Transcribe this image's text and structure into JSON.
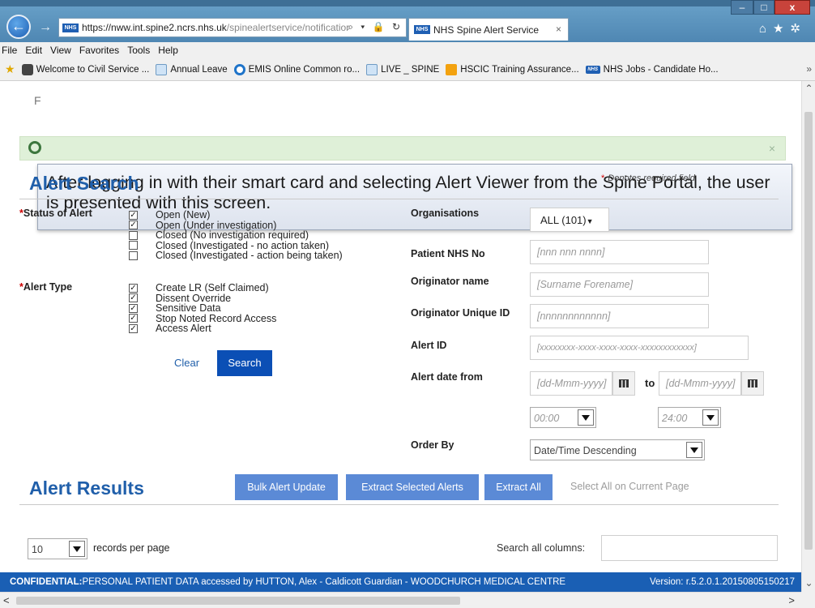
{
  "browser": {
    "url_host": "https://nww.int.spine2.ncrs.nhs.uk",
    "url_path": "/spinealertservice/notificatior",
    "tab_title": "NHS Spine Alert Service",
    "tab_close": "×",
    "nhs_badge": "NHS",
    "back_glyph": "←",
    "forward_glyph": "→",
    "addr_icons": "⌕ ▾ 🔒 ↻",
    "window_controls": {
      "min": "–",
      "max": "□",
      "close": "x"
    },
    "toolbar_icons": "⌂★✲",
    "more_glyph": "»"
  },
  "menubar": [
    "File",
    "Edit",
    "View",
    "Favorites",
    "Tools",
    "Help"
  ],
  "favorites": [
    {
      "label": "Welcome to Civil Service ...",
      "icon": "crest"
    },
    {
      "label": "Annual Leave",
      "icon": "page"
    },
    {
      "label": "EMIS Online Common ro...",
      "icon": "ie"
    },
    {
      "label": "LIVE _ SPINE",
      "icon": "page"
    },
    {
      "label": "HSCIC Training Assurance...",
      "icon": "hscic"
    },
    {
      "label": "NHS Jobs - Candidate Ho...",
      "icon": "nhs"
    }
  ],
  "page": {
    "nav_letter": "F",
    "banner_close": "×",
    "tooltip_text": "After logging in with their smart card and selecting Alert Viewer from the Spine Portal, the user is presented with this screen.",
    "alert_search": {
      "heading": "Alert Search",
      "required_star": "*",
      "required_note": "Denotes required field",
      "status_label": "Status of Alert",
      "status_options": [
        {
          "label": "Open (New)",
          "checked": true
        },
        {
          "label": "Open (Under investigation)",
          "checked": true
        },
        {
          "label": "Closed (No investigation required)",
          "checked": false
        },
        {
          "label": "Closed (Investigated - no action taken)",
          "checked": false
        },
        {
          "label": "Closed (Investigated - action being taken)",
          "checked": false
        }
      ],
      "type_label": "Alert Type",
      "type_options": [
        {
          "label": "Create LR (Self Claimed)",
          "checked": true
        },
        {
          "label": "Dissent Override",
          "checked": true
        },
        {
          "label": "Sensitive Data",
          "checked": true
        },
        {
          "label": "Stop Noted Record Access",
          "checked": true
        },
        {
          "label": "Access Alert",
          "checked": true
        }
      ],
      "clear_label": "Clear",
      "search_label": "Search",
      "organisations_label": "Organisations",
      "organisations_value": "ALL (101)",
      "patient_nhs_label": "Patient NHS No",
      "patient_nhs_placeholder": "[nnn nnn nnnn]",
      "originator_name_label": "Originator name",
      "originator_name_placeholder": "[Surname Forename]",
      "originator_uid_label": "Originator Unique ID",
      "originator_uid_placeholder": "[nnnnnnnnnnnn]",
      "alert_id_label": "Alert ID",
      "alert_id_placeholder": "[xxxxxxxx-xxxx-xxxx-xxxx-xxxxxxxxxxxx]",
      "date_from_label": "Alert date from",
      "date_from_placeholder": "[dd-Mmm-yyyy]",
      "to_label": "to",
      "date_to_placeholder": "[dd-Mmm-yyyy]",
      "time_from": "00:00",
      "time_to": "24:00",
      "order_by_label": "Order By",
      "order_by_value": "Date/Time Descending"
    },
    "alert_results": {
      "heading": "Alert Results",
      "bulk_update": "Bulk Alert Update",
      "extract_selected": "Extract Selected Alerts",
      "extract_all": "Extract All",
      "select_all": "Select All on Current Page",
      "records_value": "10",
      "records_label": "records per page",
      "search_columns_label": "Search all columns:"
    },
    "footer": {
      "confidential": "CONFIDENTIAL:",
      "text": " PERSONAL PATIENT DATA accessed by HUTTON, Alex - Caldicott Guardian - WOODCHURCH MEDICAL CENTRE",
      "version": "Version: r.5.2.0.1.20150805150217"
    }
  },
  "colors": {
    "heading_blue": "#205faa",
    "search_button": "#0b4fb5",
    "action_button": "#5b8ad6",
    "footer_blue": "#1a5fb4",
    "banner_green": "#dff0d8",
    "required_red": "#cc0000"
  }
}
